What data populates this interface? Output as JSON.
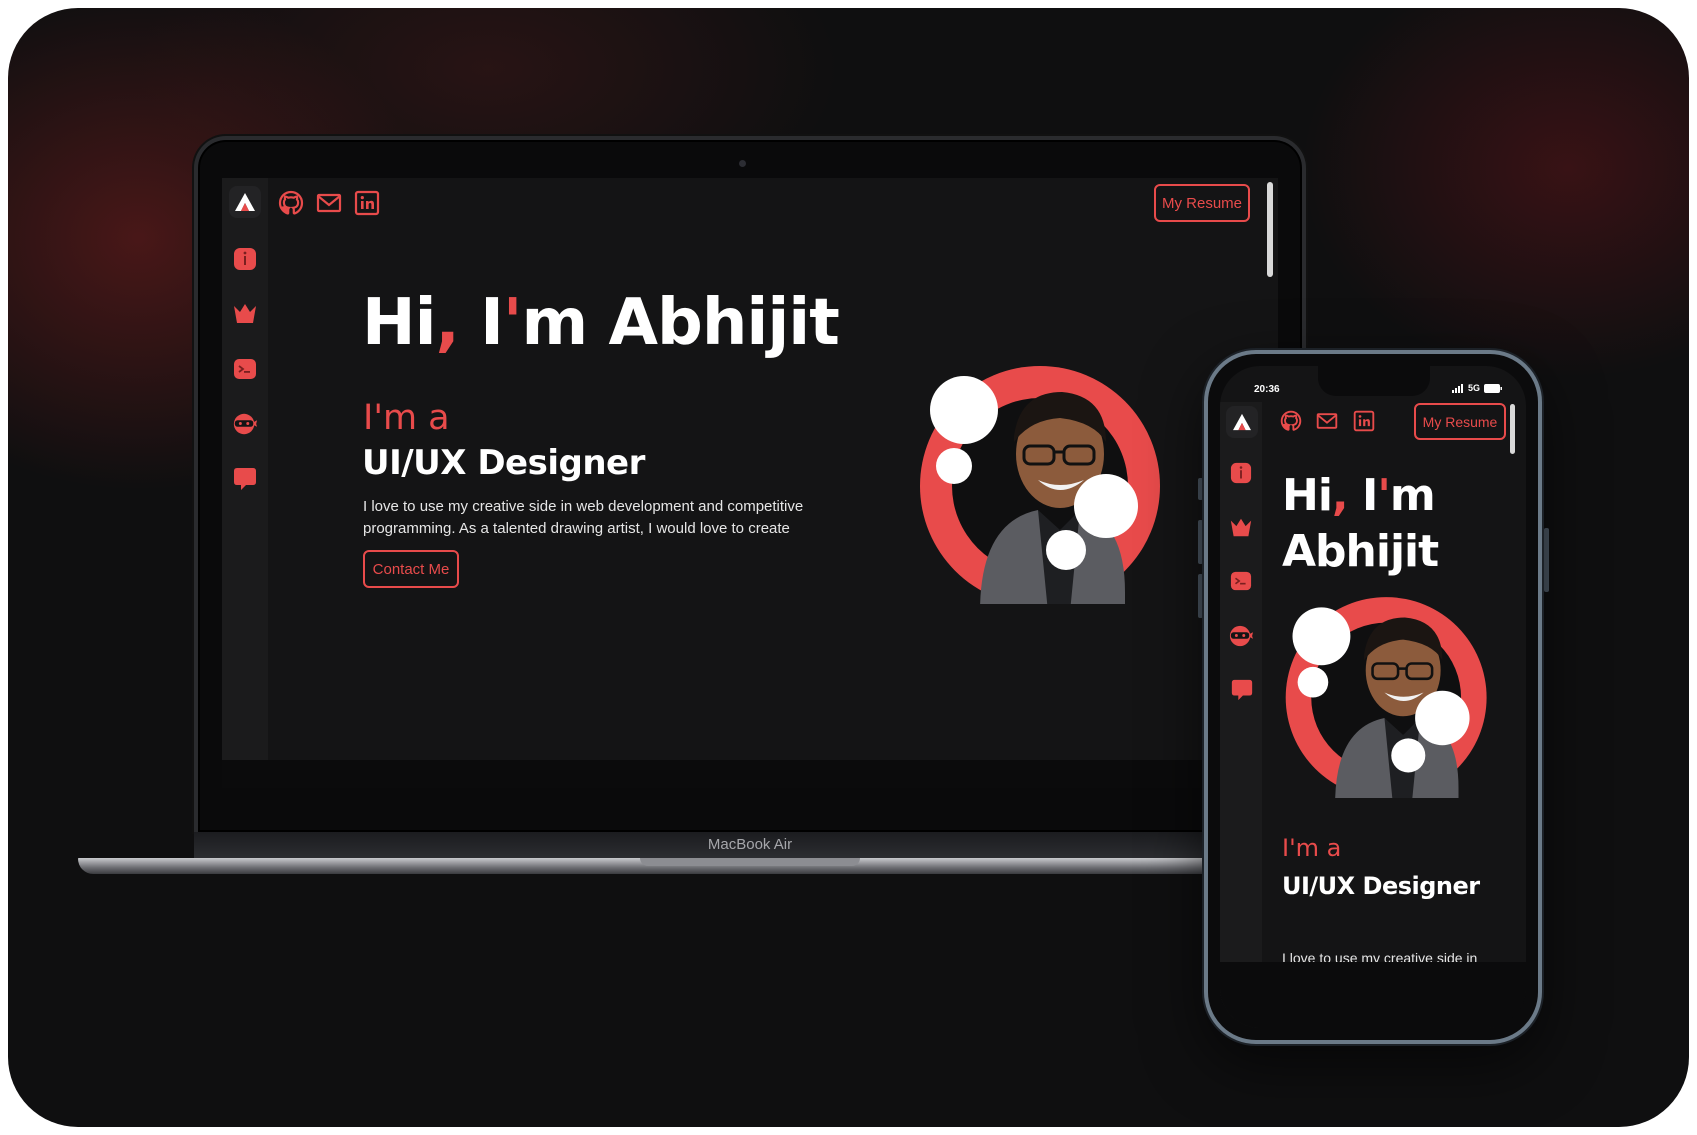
{
  "colors": {
    "accent": "#e84b4b",
    "background": "#141415",
    "sidebar": "#1b1b1c",
    "text": "#ffffff"
  },
  "icons": {
    "logo": "logo-icon",
    "top": [
      "github-icon",
      "mail-icon",
      "linkedin-icon"
    ],
    "sidebar": [
      "info-icon",
      "crown-icon",
      "terminal-icon",
      "ninja-icon",
      "chat-icon"
    ]
  },
  "desktop": {
    "resume_label": "My Resume",
    "greeting": {
      "hi": "Hi",
      "comma": ",",
      "i": "I",
      "apostrophe": "'",
      "m": "m",
      "name": "Abhijit"
    },
    "ima": "I'm a",
    "role": "UI/UX Designer",
    "bio_line1": "I love to use my creative side in web development and competitive",
    "bio_line2": "programming. As a talented drawing artist, I would love to create",
    "contact_label": "Contact Me"
  },
  "laptop_label": "MacBook Air",
  "mobile": {
    "status_time": "20:36",
    "status_network": "5G",
    "resume_label": "My Resume",
    "greeting": {
      "hi": "Hi",
      "comma": ",",
      "i": "I",
      "apostrophe": "'",
      "m": "m",
      "name": "Abhijit"
    },
    "ima": "I'm a",
    "role": "UI/UX Designer",
    "bio_partial": "I love to use my creative side in"
  }
}
